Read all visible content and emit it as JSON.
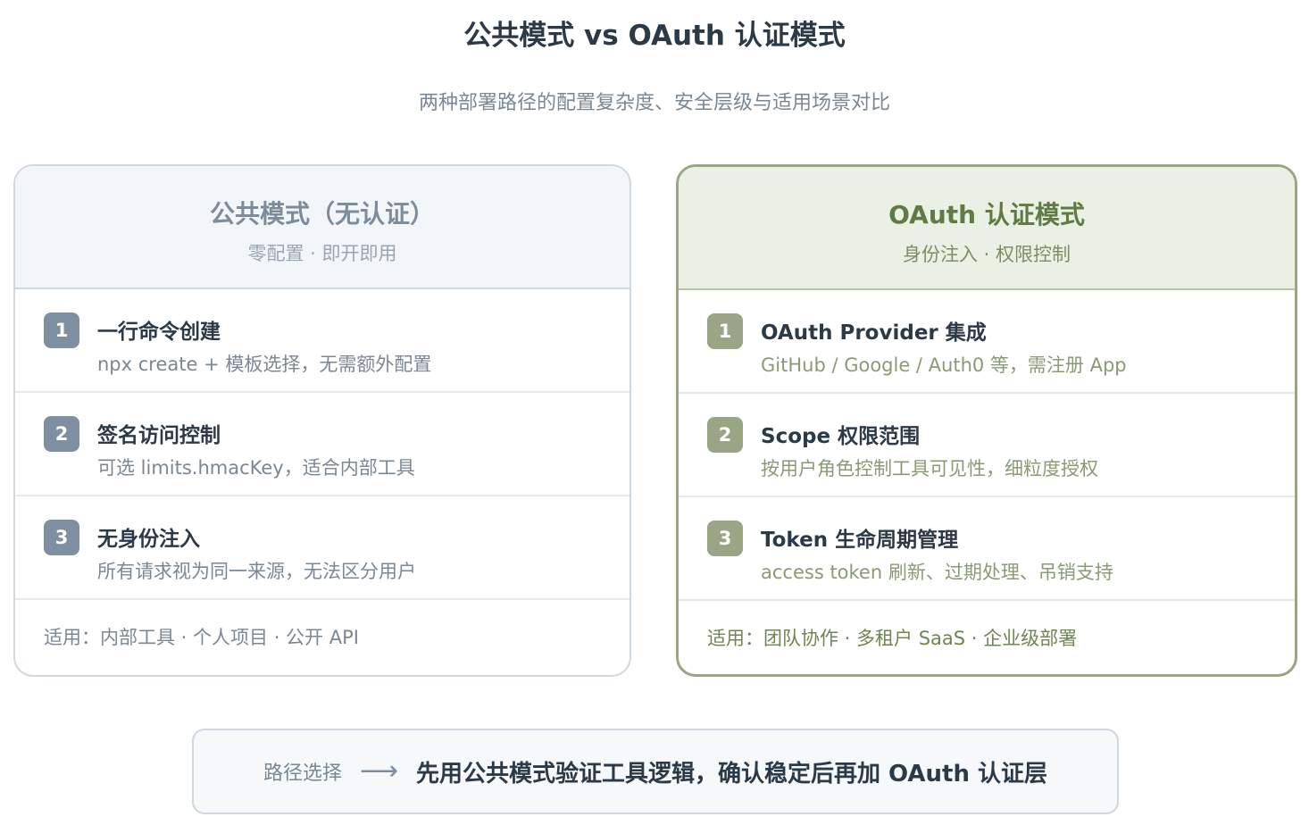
{
  "header": {
    "title": "公共模式 vs OAuth 认证模式",
    "subtitle": "两种部署路径的配置复杂度、安全层级与适用场景对比"
  },
  "public_mode": {
    "title": "公共模式（无认证）",
    "subtitle": "零配置 · 即开即用",
    "items": [
      {
        "num": "1",
        "title": "一行命令创建",
        "desc": "npx create + 模板选择，无需额外配置"
      },
      {
        "num": "2",
        "title": "签名访问控制",
        "desc": "可选 limits.hmacKey，适合内部工具"
      },
      {
        "num": "3",
        "title": "无身份注入",
        "desc": "所有请求视为同一来源，无法区分用户"
      }
    ],
    "footer": "适用：内部工具 · 个人项目 · 公开 API"
  },
  "oauth_mode": {
    "title": "OAuth 认证模式",
    "subtitle": "身份注入 · 权限控制",
    "items": [
      {
        "num": "1",
        "title": "OAuth Provider 集成",
        "desc": "GitHub / Google / Auth0 等，需注册 App"
      },
      {
        "num": "2",
        "title": "Scope 权限范围",
        "desc": "按用户角色控制工具可见性，细粒度授权"
      },
      {
        "num": "3",
        "title": "Token 生命周期管理",
        "desc": "access token 刷新、过期处理、吊销支持"
      }
    ],
    "footer": "适用：团队协作 · 多租户 SaaS · 企业级部署"
  },
  "path": {
    "label": "路径选择",
    "arrow_icon": "right-arrow-icon",
    "text": "先用公共模式验证工具逻辑，确认稳定后再加 OAuth 认证层"
  },
  "colors": {
    "public_accent": "#7e8fa2",
    "oauth_accent": "#9aa585",
    "oauth_title": "#5f7a45",
    "text_dark": "#2c3a48"
  }
}
